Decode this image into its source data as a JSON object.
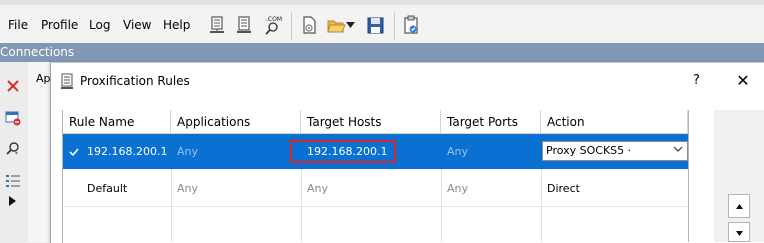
{
  "menu": {
    "file": "File",
    "profile": "Profile",
    "log": "Log",
    "view": "View",
    "help": "Help"
  },
  "toolbar_icons": [
    "server-icon",
    "document-icon",
    "dns-lookup-icon",
    "settings-page-icon",
    "open-folder-icon",
    "dropdown-arrow-icon",
    "save-icon",
    "clipboard-icon"
  ],
  "connections_header": "Connections",
  "behind_panel_label": "Ap",
  "dialog": {
    "title": "Proxification Rules",
    "help": "?",
    "close": "✕"
  },
  "table": {
    "columns": [
      "Rule Name",
      "Applications",
      "Target Hosts",
      "Target Ports",
      "Action"
    ],
    "rows": [
      {
        "rule_name": "192.168.200.1",
        "applications": "Any",
        "target_hosts": "192.168.200.1",
        "target_ports": "Any",
        "action": "Proxy SOCKS5 ·",
        "checked": true,
        "selected": true
      },
      {
        "rule_name": "Default",
        "applications": "Any",
        "target_hosts": "Any",
        "target_ports": "Any",
        "action": "Direct",
        "checked": false,
        "selected": false
      }
    ]
  },
  "colors": {
    "selection": "#0a70d1",
    "header_bar": "#8297b3",
    "highlight_border": "#d9262a",
    "delete_red": "#d32f2f"
  }
}
